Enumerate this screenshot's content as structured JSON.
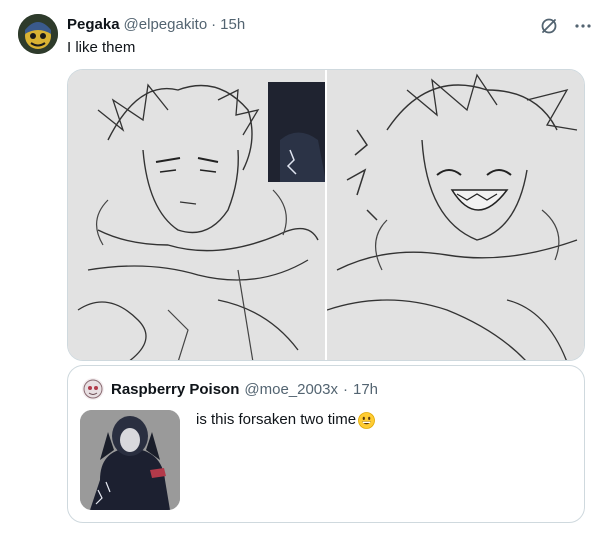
{
  "tweet": {
    "author_name": "Pegaka",
    "author_handle": "@elpegakito",
    "separator": "·",
    "time": "15h",
    "text": "I like them",
    "icons": {
      "grok": "grok-icon",
      "more": "more-options-icon"
    }
  },
  "quote": {
    "author_name": "Raspberry Poison",
    "author_handle": "@moe_2003x",
    "separator": "·",
    "time": "17h",
    "text": "is this forsaken two time",
    "emoji": "grinning-face-emoji"
  },
  "colors": {
    "text_primary": "#0f1419",
    "text_secondary": "#536471",
    "border": "#cfd9de"
  }
}
